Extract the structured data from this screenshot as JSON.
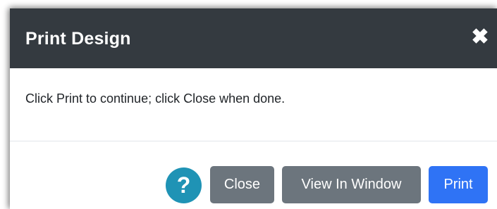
{
  "dialog": {
    "title": "Print Design",
    "close_icon_glyph": "✖",
    "message": "Click Print to continue; click Close when done.",
    "help_icon_glyph": "?",
    "buttons": {
      "close": "Close",
      "view_in_window": "View In Window",
      "print": "Print"
    }
  },
  "colors": {
    "header_bg": "#343a40",
    "secondary_button": "#6c757d",
    "primary_button": "#2f73f5",
    "help_icon": "#1f93b5"
  }
}
